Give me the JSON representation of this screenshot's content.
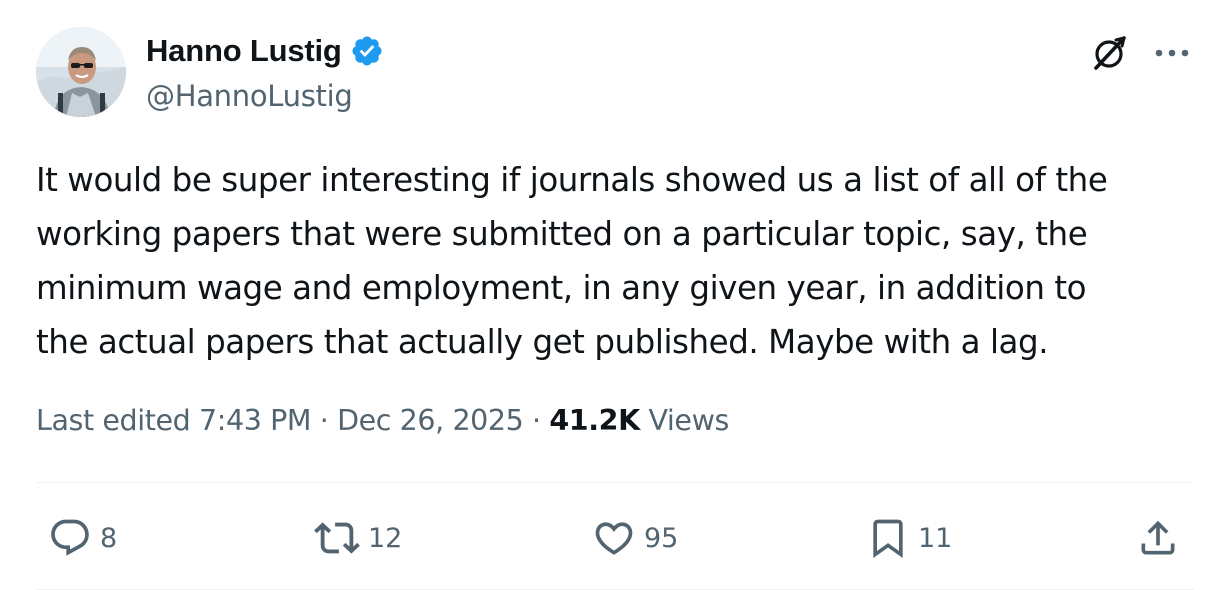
{
  "author": {
    "display_name": "Hanno Lustig",
    "handle": "@HannoLustig",
    "verified": true
  },
  "tweet": {
    "text": "It would be super interesting if journals showed us a list of all of the\nworking papers that were submitted on a particular topic, say, the\nminimum wage and employment, in any given year, in addition to\nthe actual papers that actually get published. Maybe with a lag."
  },
  "meta": {
    "edited_prefix": "Last edited ",
    "time": "7:43 PM",
    "sep1": " · ",
    "date": "Dec 26, 2025",
    "sep2": " · ",
    "views_count": "41.2K",
    "views_label": " Views"
  },
  "actions": {
    "replies": "8",
    "reposts": "12",
    "likes": "95",
    "bookmarks": "11"
  },
  "icons": {
    "verified": "verified-badge-icon",
    "grok": "grok-icon",
    "more": "more-icon",
    "reply": "reply-icon",
    "repost": "repost-icon",
    "like": "heart-icon",
    "bookmark": "bookmark-icon",
    "share": "share-icon"
  },
  "colors": {
    "text_primary": "#0f1419",
    "text_secondary": "#536471",
    "verified_blue": "#1d9bf0",
    "divider": "#eff3f4"
  }
}
